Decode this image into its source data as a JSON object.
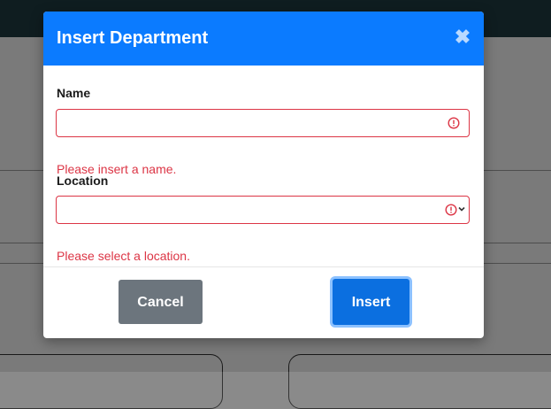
{
  "modal": {
    "title": "Insert Department",
    "close_icon": "close-icon"
  },
  "form": {
    "name": {
      "label": "Name",
      "value": "",
      "error": "Please insert a name."
    },
    "location": {
      "label": "Location",
      "selected": "",
      "error": "Please select a location."
    }
  },
  "buttons": {
    "cancel_label": "Cancel",
    "insert_label": "Insert"
  },
  "colors": {
    "header": "#0b7bff",
    "error": "#dc3545",
    "cancel": "#6c757d",
    "insert": "#0b6fe0"
  }
}
